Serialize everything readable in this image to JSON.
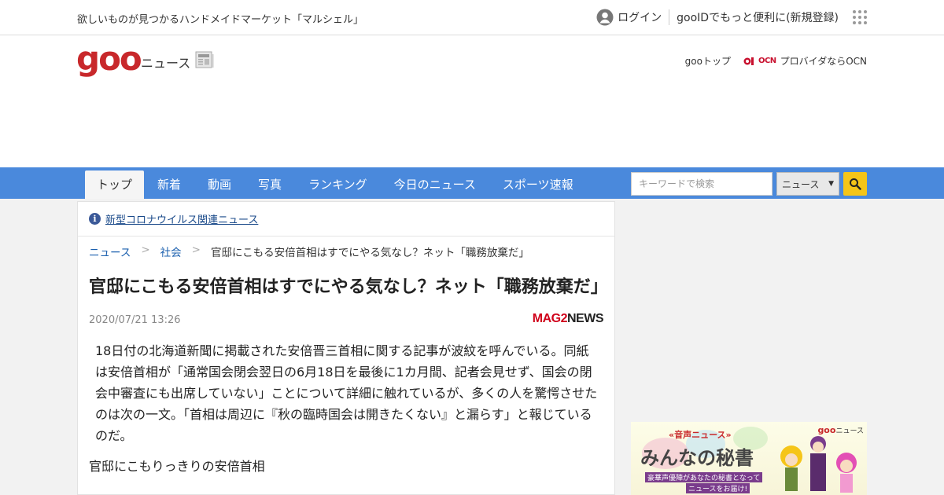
{
  "topbar": {
    "promo": "欲しいものが見つかるハンドメイドマーケット「マルシェル」",
    "login": "ログイン",
    "register": "gooIDでもっと便利に(新規登録)"
  },
  "header": {
    "logo": "goo",
    "logo_sub": "ニュース",
    "goo_top": "gooトップ",
    "ocn_logo": "OCN",
    "ocn_text": "プロバイダならOCN"
  },
  "nav": {
    "tabs": [
      {
        "label": "トップ",
        "active": true
      },
      {
        "label": "新着"
      },
      {
        "label": "動画"
      },
      {
        "label": "写真"
      },
      {
        "label": "ランキング"
      },
      {
        "label": "今日のニュース"
      },
      {
        "label": "スポーツ速報"
      }
    ],
    "search_placeholder": "キーワードで検索",
    "search_scope": "ニュース"
  },
  "article": {
    "covid_link": "新型コロナウイルス関連ニュース",
    "breadcrumb": [
      "ニュース",
      "社会",
      "官邸にこもる安倍首相はすでにやる気なし？ネット「職務放棄だ」"
    ],
    "title": "官邸にこもる安倍首相はすでにやる気なし？ネット「職務放棄だ」",
    "date": "2020/07/21 13:26",
    "source_mark": "MAG2",
    "source_word": "NEWS",
    "lead": "18日付の北海道新聞に掲載された安倍晋三首相に関する記事が波紋を呼んでいる。同紙は安倍首相が「通常国会閉会翌日の6月18日を最後に1カ月間、記者会見せず、国会の閉会中審査にも出席していない」ことについて詳細に触れているが、多くの人を驚愕させたのは次の一文。「首相は周辺に『秋の臨時国会は開きたくない』と漏らす」と報じているのだ。",
    "subhead": "官邸にこもりっきりの安倍首相"
  },
  "ad": {
    "brand": "goo",
    "brand_sub": "ニュース",
    "tag": "«音声ニュース»",
    "title": "みんなの秘書",
    "sub1": "豪華声優陣があなたの秘書となって",
    "sub2": "ニュースをお届け!"
  },
  "colors": {
    "nav_bg": "#4a89dc",
    "brand_red": "#c8282b",
    "search_button": "#f5c518",
    "link": "#1a5fae"
  }
}
